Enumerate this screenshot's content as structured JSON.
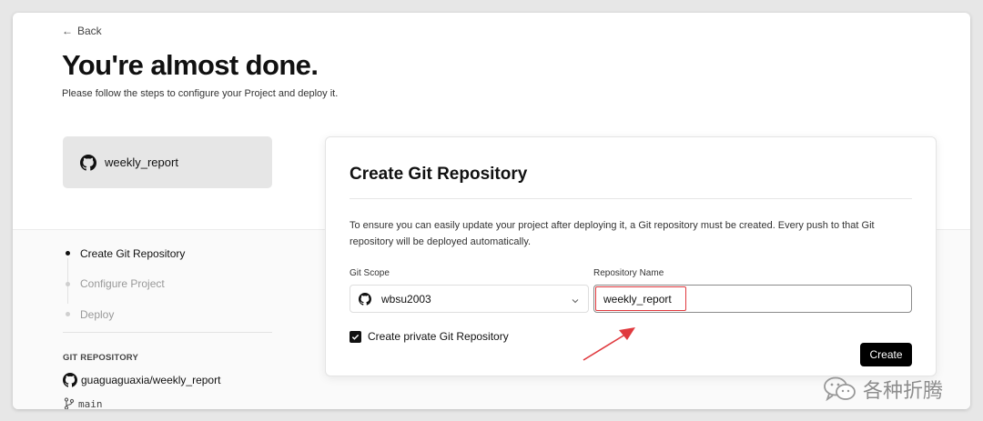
{
  "header": {
    "back_label": "Back",
    "title": "You're almost done.",
    "subtitle": "Please follow the steps to configure your Project and deploy it."
  },
  "repo_card": {
    "icon": "github-icon",
    "name": "weekly_report"
  },
  "steps": [
    {
      "label": "Create Git Repository",
      "active": true
    },
    {
      "label": "Configure Project",
      "active": false
    },
    {
      "label": "Deploy",
      "active": false
    }
  ],
  "git_repository": {
    "section_label": "GIT REPOSITORY",
    "repo": "guaguaguaxia/weekly_report",
    "branch": "main"
  },
  "panel": {
    "title": "Create Git Repository",
    "description": "To ensure you can easily update your project after deploying it, a Git repository must be created. Every push to that Git repository will be deployed automatically.",
    "git_scope_label": "Git Scope",
    "git_scope_value": "wbsu2003",
    "repository_name_label": "Repository Name",
    "repository_name_value": "weekly_report",
    "private_checkbox_label": "Create private Git Repository",
    "private_checked": true,
    "create_button": "Create"
  },
  "annotation": {
    "color": "#e0393e"
  },
  "watermark": {
    "text": "各种折腾",
    "icon": "wechat-icon"
  }
}
